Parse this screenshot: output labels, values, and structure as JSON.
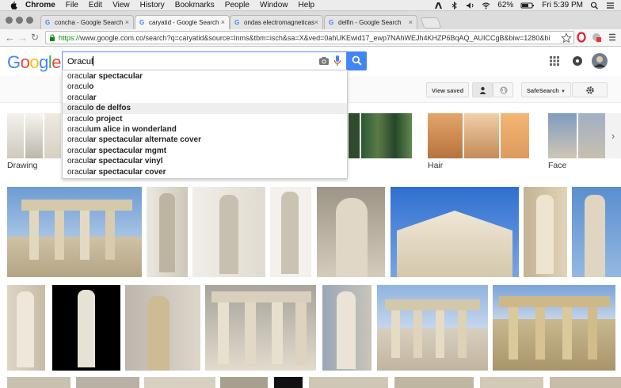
{
  "menubar": {
    "app": "Chrome",
    "menus": [
      "File",
      "Edit",
      "View",
      "History",
      "Bookmarks",
      "People",
      "Window",
      "Help"
    ],
    "battery": "62%",
    "clock": "Fri 5:39 PM"
  },
  "tabs": [
    {
      "title": "concha - Google Search",
      "active": false
    },
    {
      "title": "caryatid - Google Search",
      "active": true
    },
    {
      "title": "ondas electromagneticas",
      "active": false
    },
    {
      "title": "delfin - Google Search",
      "active": false
    }
  ],
  "address": {
    "scheme": "https://",
    "rest": "www.google.com.co/search?q=caryatid&source=lnms&tbm=isch&sa=X&ved=0ahUKEwid17_ewp7NAhWEJh4KHZP6BqAQ_AUICCgB&biw=1280&bi"
  },
  "google": {
    "logo_letters": [
      "G",
      "o",
      "o",
      "g",
      "l",
      "e"
    ],
    "logo_colors": [
      "#4285f4",
      "#ea4335",
      "#fbbc05",
      "#4285f4",
      "#34a853",
      "#ea4335"
    ],
    "query": "Oracul"
  },
  "suggestions": [
    {
      "typed": "oracul",
      "rest": "ar spectacular",
      "highlight": false
    },
    {
      "typed": "oracul",
      "rest": "o",
      "highlight": false
    },
    {
      "typed": "oracul",
      "rest": "ar",
      "highlight": false
    },
    {
      "typed": "oracul",
      "rest": "o de delfos",
      "highlight": true
    },
    {
      "typed": "oracul",
      "rest": "o project",
      "highlight": false
    },
    {
      "typed": "oracul",
      "rest": "um alice in wonderland",
      "highlight": false
    },
    {
      "typed": "oracul",
      "rest": "ar spectacular alternate cover",
      "highlight": false
    },
    {
      "typed": "oracul",
      "rest": "ar spectacular mgmt",
      "highlight": false
    },
    {
      "typed": "oracul",
      "rest": "ar spectacular vinyl",
      "highlight": false
    },
    {
      "typed": "oracul",
      "rest": "ar spectacular cover",
      "highlight": false
    }
  ],
  "tools": {
    "view_saved": "View saved",
    "safesearch": "SafeSearch"
  },
  "categories": [
    {
      "label": "Drawing"
    },
    {
      "label": "Hair"
    },
    {
      "label": "Face"
    }
  ],
  "colors": {
    "accent": "#4285f4",
    "https_green": "#0a8a0a",
    "sky": "#7fa8d8",
    "marble": "#d8cfbf"
  }
}
